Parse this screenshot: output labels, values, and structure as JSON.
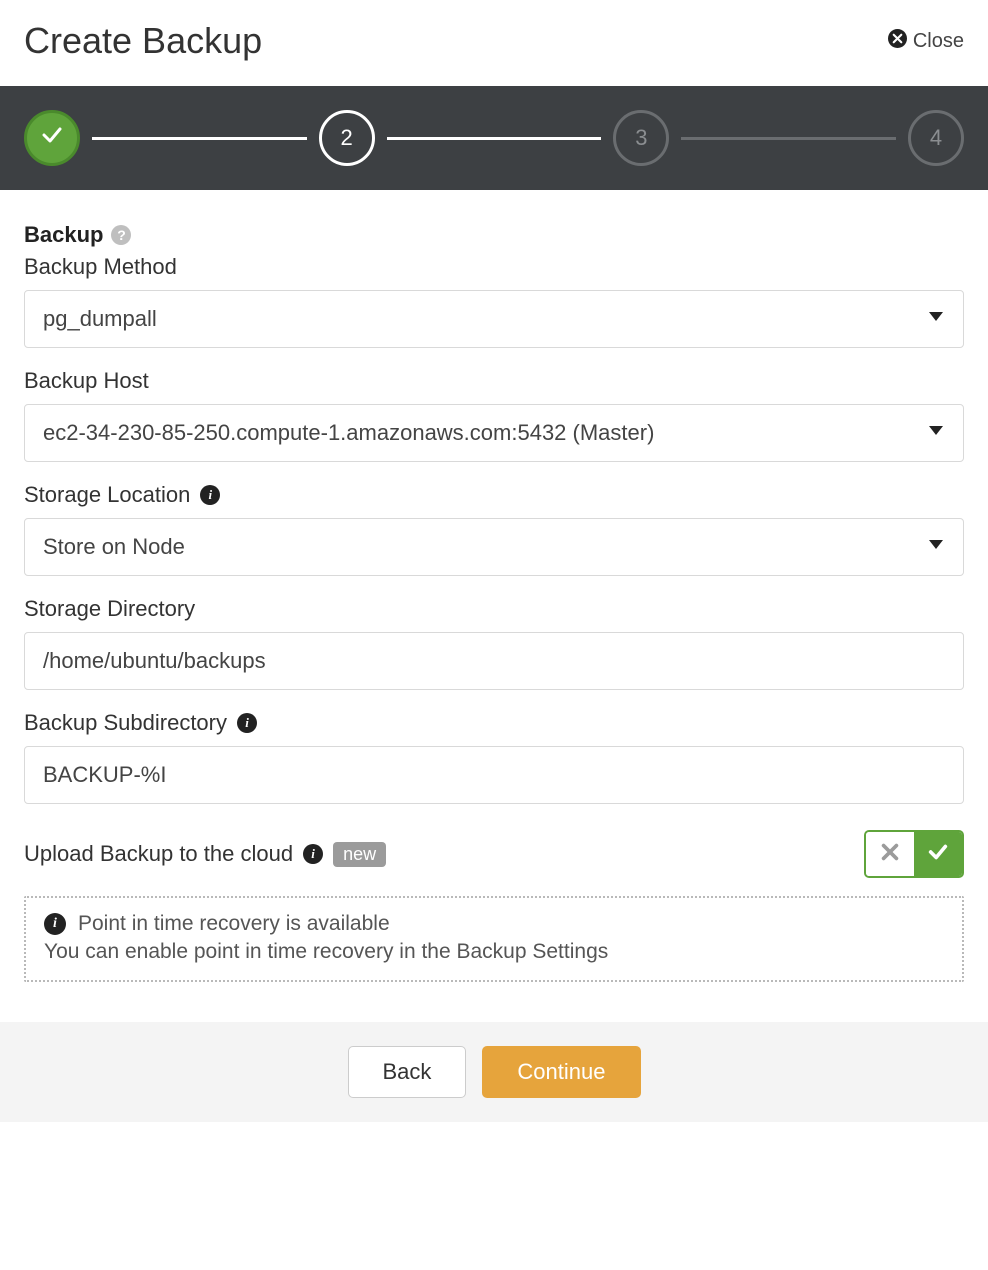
{
  "header": {
    "title": "Create Backup",
    "close_label": "Close"
  },
  "stepper": {
    "steps": [
      "done",
      "2",
      "3",
      "4"
    ]
  },
  "section": {
    "title": "Backup"
  },
  "fields": {
    "method": {
      "label": "Backup Method",
      "value": "pg_dumpall"
    },
    "host": {
      "label": "Backup Host",
      "value": "ec2-34-230-85-250.compute-1.amazonaws.com:5432 (Master)"
    },
    "location": {
      "label": "Storage Location",
      "value": "Store on Node"
    },
    "directory": {
      "label": "Storage Directory",
      "value": "/home/ubuntu/backups"
    },
    "subdir": {
      "label": "Backup Subdirectory",
      "value": "BACKUP-%I"
    }
  },
  "upload": {
    "label": "Upload Backup to the cloud",
    "badge": "new",
    "on": true
  },
  "notice": {
    "line1": "Point in time recovery is available",
    "line2": "You can enable point in time recovery in the Backup Settings"
  },
  "footer": {
    "back": "Back",
    "continue": "Continue"
  }
}
